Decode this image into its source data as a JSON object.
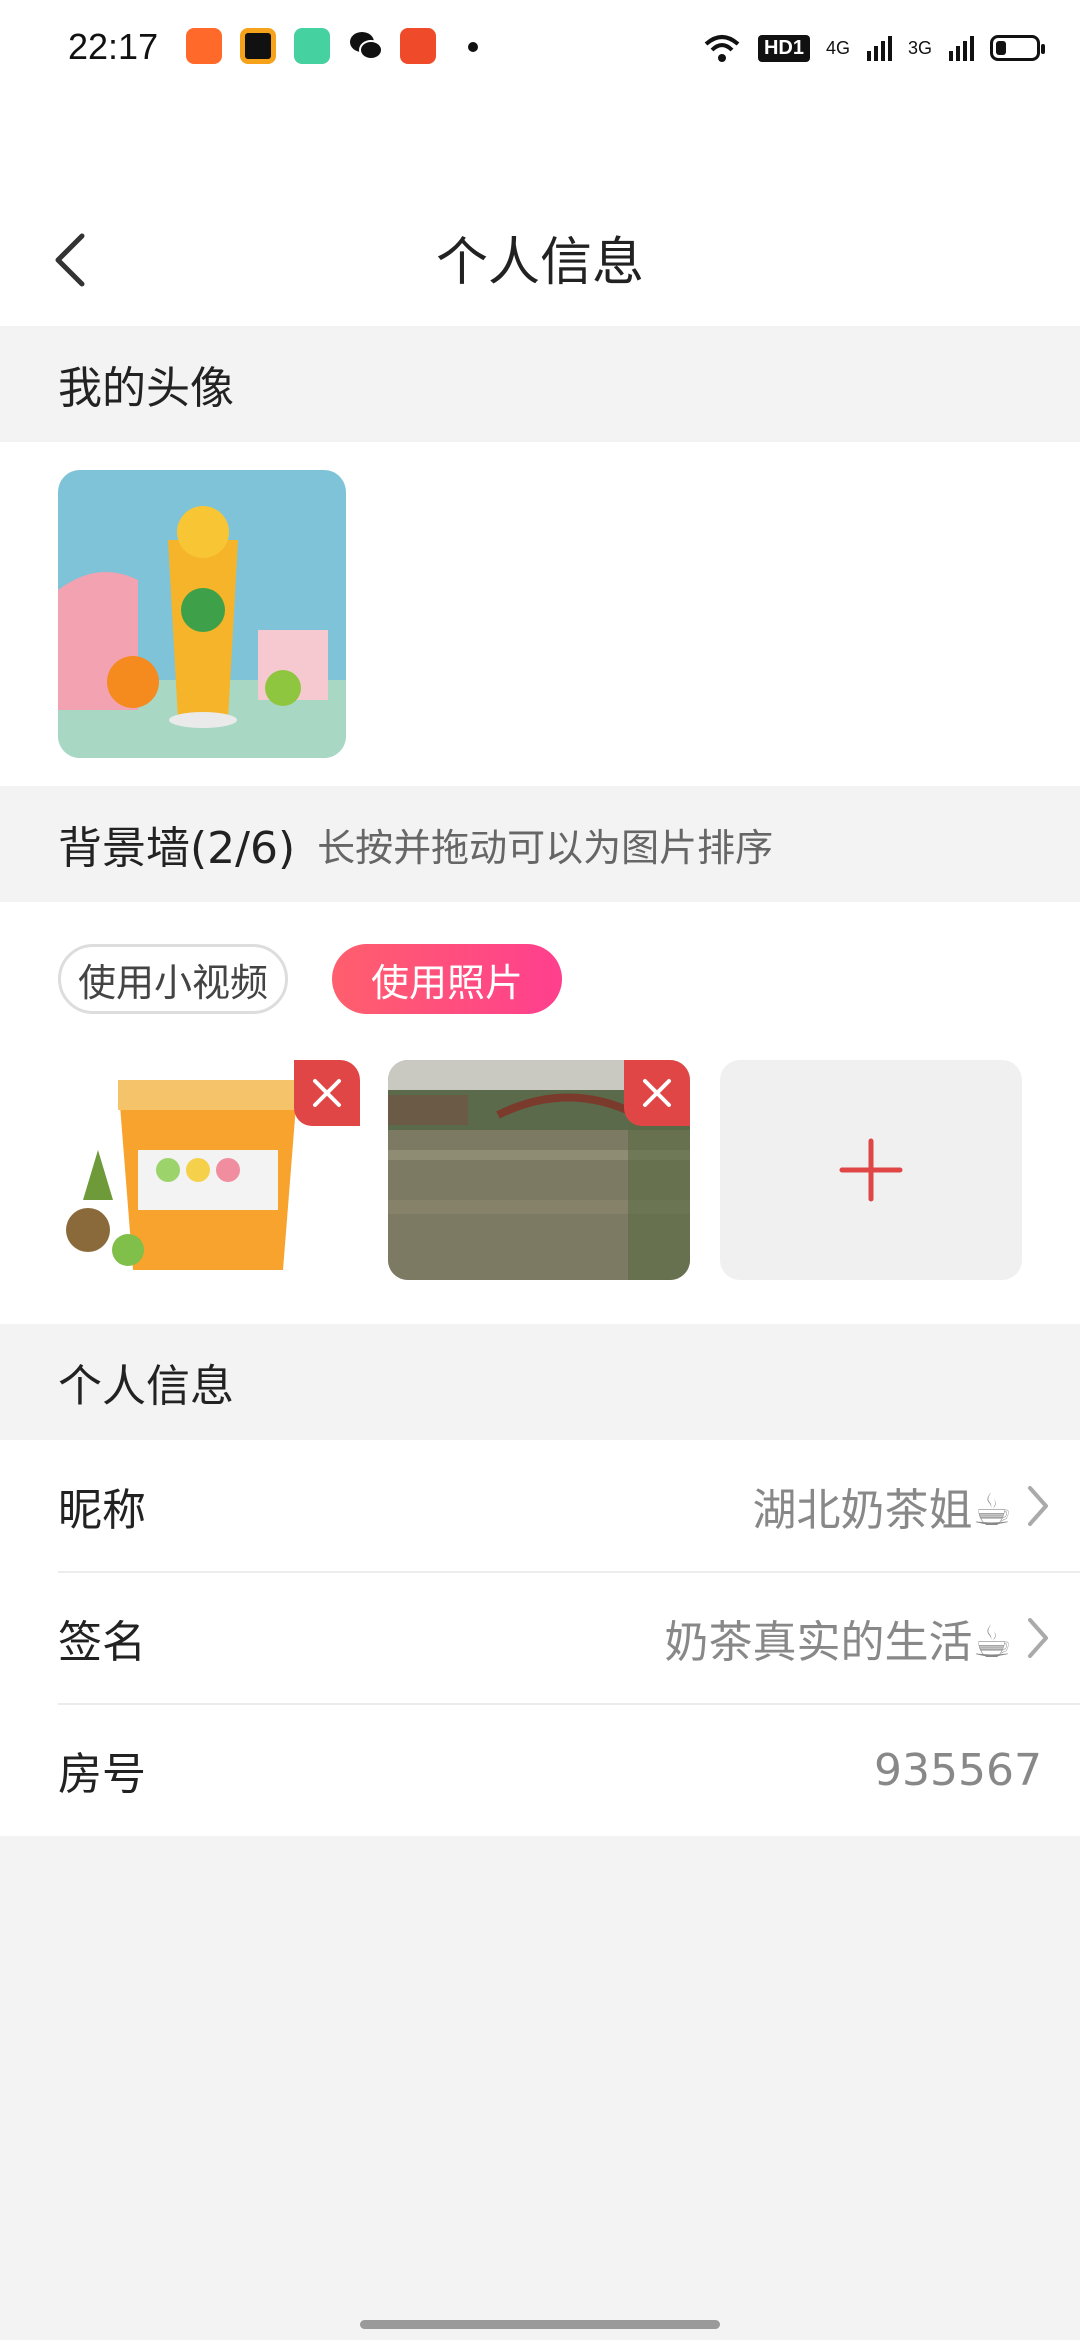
{
  "status_bar": {
    "time": "22:17",
    "hd_label": "HD1",
    "net1": "4G",
    "net2": "3G"
  },
  "header": {
    "title": "个人信息",
    "back_icon": "chevron-left-icon"
  },
  "avatar_section": {
    "title": "我的头像"
  },
  "background_wall": {
    "title": "背景墙(2/6)",
    "hint": "长按并拖动可以为图片排序",
    "chips": {
      "video": "使用小视频",
      "photo": "使用照片"
    },
    "add_icon": "plus-icon",
    "remove_icon": "close-icon"
  },
  "info_section": {
    "title": "个人信息",
    "rows": [
      {
        "label": "昵称",
        "value": "湖北奶茶姐☕"
      },
      {
        "label": "签名",
        "value": "奶茶真实的生活☕"
      },
      {
        "label": "房号",
        "value": "935567"
      }
    ]
  },
  "colors": {
    "accent_gradient_start": "#ff5f6d",
    "accent_gradient_end": "#ff3f8e",
    "remove_badge": "#e04646",
    "plus": "#e04646"
  }
}
